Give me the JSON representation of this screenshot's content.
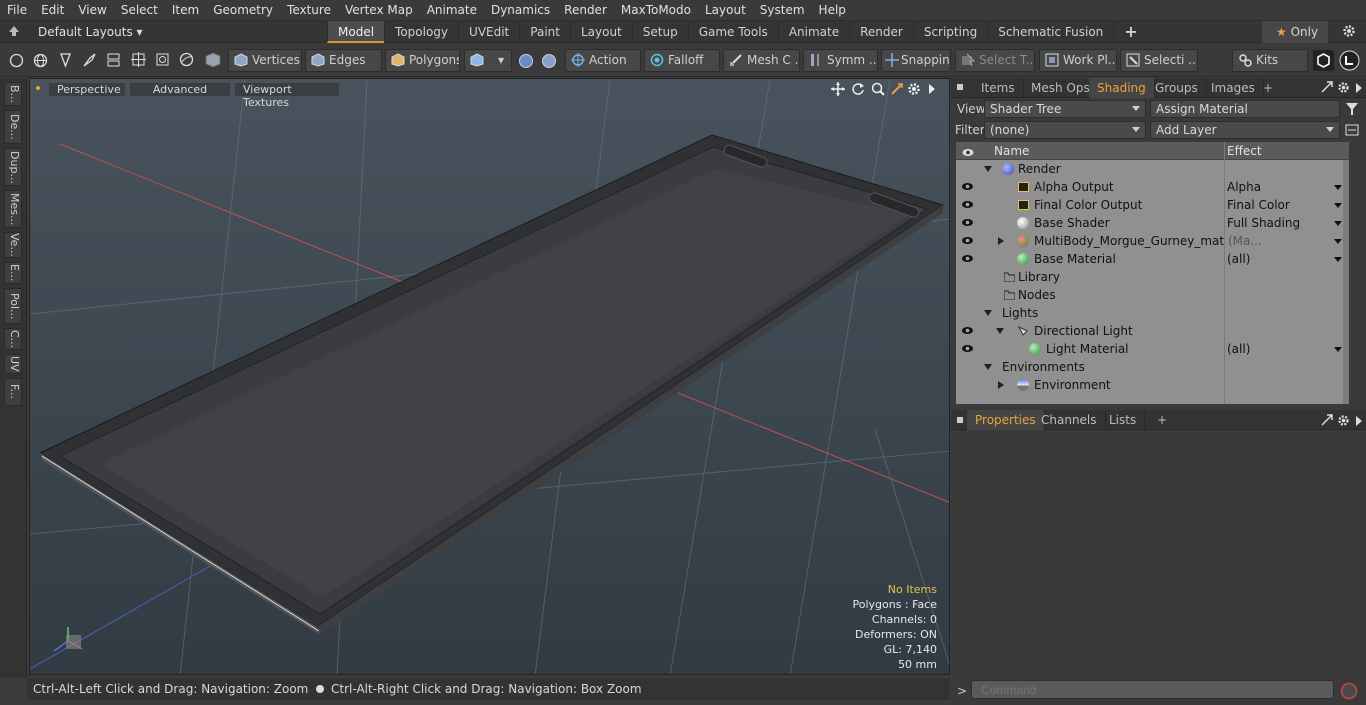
{
  "menu": [
    "File",
    "Edit",
    "View",
    "Select",
    "Item",
    "Geometry",
    "Texture",
    "Vertex Map",
    "Animate",
    "Dynamics",
    "Render",
    "MaxToModo",
    "Layout",
    "System",
    "Help"
  ],
  "layout": {
    "selector": "Default Layouts",
    "tabs": [
      "Model",
      "Topology",
      "UVEdit",
      "Paint",
      "Layout",
      "Setup",
      "Game Tools",
      "Animate",
      "Render",
      "Scripting",
      "Schematic Fusion"
    ],
    "active_tab": "Model",
    "only_label": "Only"
  },
  "toolbar": {
    "vertices": "Vertices",
    "edges": "Edges",
    "polygons": "Polygons",
    "action": "Action",
    "falloff": "Falloff",
    "mesh": "Mesh C ...",
    "symm": "Symm ...",
    "snapping": "Snapping",
    "select_t": "Select T...",
    "work_pl": "Work Pl...",
    "selecti": "Selecti ...",
    "kits": "Kits"
  },
  "left_tabs": [
    "B...",
    "De...",
    "Dup...",
    "Mes...",
    "Ve...",
    "E...",
    "Pol...",
    "C...",
    "UV",
    "F..."
  ],
  "viewport": {
    "perspective": "Perspective",
    "advanced": "Advanced",
    "textures": "Viewport Textures",
    "info_title": "No Items",
    "info_lines": [
      "Polygons : Face",
      "Channels: 0",
      "Deformers: ON",
      "GL: 7,140",
      "50 mm"
    ]
  },
  "status": {
    "left": "Ctrl-Alt-Left Click and Drag: Navigation: Zoom",
    "right": "Ctrl-Alt-Right Click and Drag: Navigation: Box Zoom"
  },
  "shader_panel": {
    "tabs": [
      "Items",
      "Mesh Ops",
      "Shading",
      "Groups",
      "Images"
    ],
    "active_tab": "Shading",
    "view_label": "View",
    "view_value": "Shader Tree",
    "assign": "Assign Material",
    "filter_label": "Filter",
    "filter_value": "(none)",
    "add_layer": "Add Layer",
    "col_name": "Name",
    "col_effect": "Effect",
    "rows": [
      {
        "name": "Render",
        "effect": ""
      },
      {
        "name": "Alpha Output",
        "effect": "Alpha"
      },
      {
        "name": "Final Color Output",
        "effect": "Final Color"
      },
      {
        "name": "Base Shader",
        "effect": "Full Shading"
      },
      {
        "name": "MultiBody_Morgue_Gurney_mat",
        "suffix": "(Ma...",
        "effect": ""
      },
      {
        "name": "Base Material",
        "effect": "(all)"
      },
      {
        "name": "Library",
        "effect": ""
      },
      {
        "name": "Nodes",
        "effect": ""
      },
      {
        "name": "Lights",
        "effect": ""
      },
      {
        "name": "Directional Light",
        "effect": ""
      },
      {
        "name": "Light Material",
        "effect": "(all)"
      },
      {
        "name": "Environments",
        "effect": ""
      },
      {
        "name": "Environment",
        "effect": ""
      }
    ]
  },
  "properties_panel": {
    "tabs": [
      "Properties",
      "Channels",
      "Lists"
    ],
    "active_tab": "Properties"
  },
  "command": {
    "placeholder": "Command"
  },
  "colors": {
    "accent": "#e8a43a",
    "tree_bg": "#909090",
    "viewport_bg": "#3d4852"
  }
}
